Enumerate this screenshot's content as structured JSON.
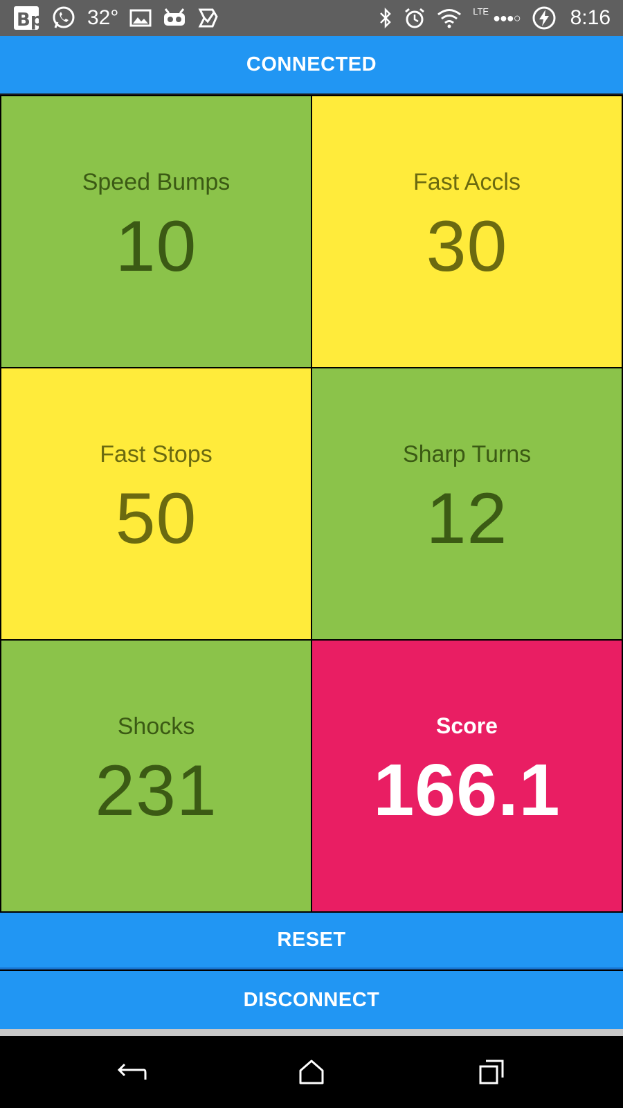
{
  "status_bar": {
    "temperature": "32°",
    "network": "LTE",
    "signal_dots": "●●●○",
    "time": "8:16",
    "icons_left": [
      "news-app-icon",
      "whatsapp-icon",
      "gallery-icon",
      "bot-icon",
      "task-check-icon"
    ],
    "icons_right": [
      "bluetooth-icon",
      "alarm-icon",
      "wifi-icon",
      "battery-charging-icon"
    ]
  },
  "connection": {
    "status_label": "CONNECTED",
    "color": "#2196f3"
  },
  "metrics": [
    {
      "label": "Speed Bumps",
      "value": "10",
      "color": "#8bc34a"
    },
    {
      "label": "Fast Accls",
      "value": "30",
      "color": "#ffeb3b"
    },
    {
      "label": "Fast Stops",
      "value": "50",
      "color": "#ffeb3b"
    },
    {
      "label": "Sharp Turns",
      "value": "12",
      "color": "#8bc34a"
    },
    {
      "label": "Shocks",
      "value": "231",
      "color": "#8bc34a"
    }
  ],
  "score": {
    "label": "Score",
    "value": "166.1",
    "color": "#e91e63"
  },
  "actions": {
    "reset_label": "RESET",
    "disconnect_label": "DISCONNECT"
  },
  "nav": [
    "back-icon",
    "home-icon",
    "recents-icon"
  ]
}
